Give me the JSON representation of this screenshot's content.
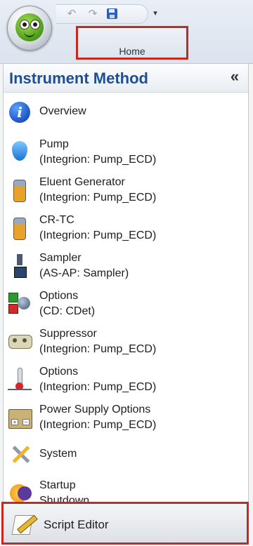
{
  "ribbon": {
    "quick_access": {
      "undo_icon": "undo-icon",
      "redo_icon": "redo-icon",
      "save_icon": "save-icon",
      "dropdown_icon": "customize-toolbar-icon"
    },
    "tab_home": "Home"
  },
  "nav": {
    "title": "Instrument Method",
    "collapse_glyph": "«",
    "items": [
      {
        "label": "Overview",
        "sub": "",
        "icon": "info-icon"
      },
      {
        "label": "Pump",
        "sub": "(Integrion: Pump_ECD)",
        "icon": "water-drop-icon"
      },
      {
        "label": "Eluent Generator",
        "sub": "(Integrion: Pump_ECD)",
        "icon": "cartridge-icon"
      },
      {
        "label": "CR-TC",
        "sub": "(Integrion: Pump_ECD)",
        "icon": "cartridge-icon"
      },
      {
        "label": "Sampler",
        "sub": "(AS-AP: Sampler)",
        "icon": "sampler-icon"
      },
      {
        "label": "Options",
        "sub": "(CD: CDet)",
        "icon": "detector-options-icon"
      },
      {
        "label": "Suppressor",
        "sub": "(Integrion: Pump_ECD)",
        "icon": "suppressor-icon"
      },
      {
        "label": "Options",
        "sub": "(Integrion: Pump_ECD)",
        "icon": "thermometer-icon"
      },
      {
        "label": "Power Supply Options",
        "sub": "(Integrion: Pump_ECD)",
        "icon": "power-supply-icon"
      },
      {
        "label": "System",
        "sub": "",
        "icon": "tools-icon"
      },
      {
        "label": "Startup",
        "sub": "Shutdown",
        "icon": "startup-shutdown-icon"
      }
    ],
    "script_editor": {
      "label": "Script Editor",
      "icon": "script-editor-icon"
    }
  },
  "colors": {
    "highlight": "#c9281e",
    "title_blue": "#1f4f93"
  }
}
